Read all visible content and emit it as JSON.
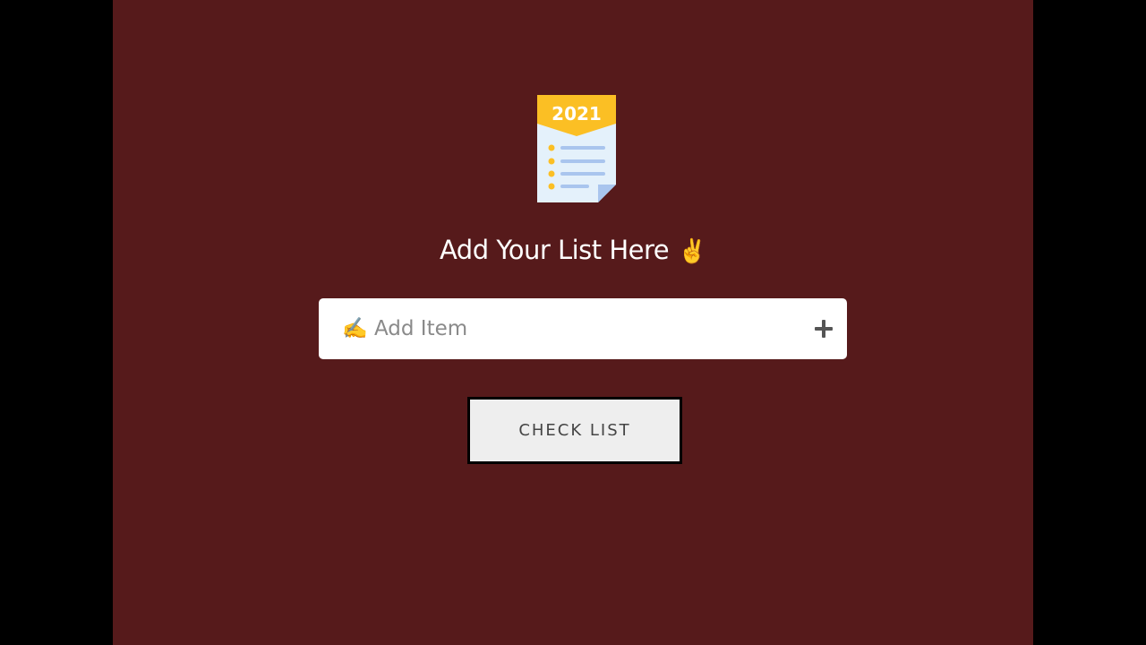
{
  "app": {
    "background": "#561a1b",
    "logo": {
      "year": "2021",
      "icon": "checklist-icon"
    },
    "heading": "Add Your List Here",
    "heading_emoji": "✌️",
    "input": {
      "placeholder": "✍️ Add Item",
      "value": "",
      "add_icon": "plus-icon"
    },
    "check_button_label": "CHECK LIST"
  }
}
